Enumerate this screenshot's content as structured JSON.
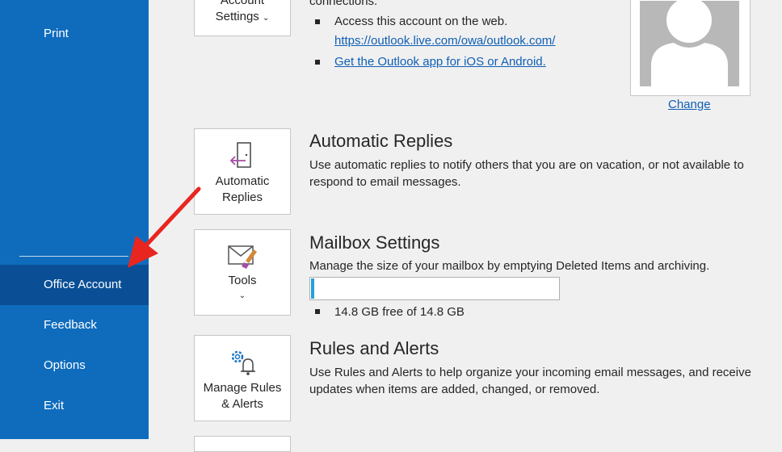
{
  "sidebar": {
    "items": [
      {
        "label": "Print"
      },
      {
        "label": "Office Account"
      },
      {
        "label": "Feedback"
      },
      {
        "label": "Options"
      },
      {
        "label": "Exit"
      }
    ],
    "active": "Office Account"
  },
  "account_settings": {
    "tile_label_line1": "Account",
    "tile_label_line2": "Settings",
    "connections_text": "connections.",
    "web_access_text": "Access this account on the web.",
    "web_link": "https://outlook.live.com/owa/outlook.com/",
    "app_link": "Get the Outlook app for iOS or Android."
  },
  "profile": {
    "change_link": "Change"
  },
  "automatic_replies": {
    "tile_line1": "Automatic",
    "tile_line2": "Replies",
    "title": "Automatic Replies",
    "description": "Use automatic replies to notify others that you are on vacation, or not available to respond to email messages."
  },
  "mailbox": {
    "tile_label": "Tools",
    "title": "Mailbox Settings",
    "description": "Manage the size of your mailbox by emptying Deleted Items and archiving.",
    "usage_fraction": 0.01,
    "free_text": "14.8 GB free of 14.8 GB"
  },
  "rules": {
    "tile_line1": "Manage Rules",
    "tile_line2": "& Alerts",
    "title": "Rules and Alerts",
    "description": "Use Rules and Alerts to help organize your incoming email messages, and receive updates when items are added, changed, or removed."
  },
  "colors": {
    "sidebar": "#0f6cbd",
    "sidebar_active": "#0a4f95",
    "link": "#0f5fb5",
    "annotation_arrow": "#e8261f"
  }
}
